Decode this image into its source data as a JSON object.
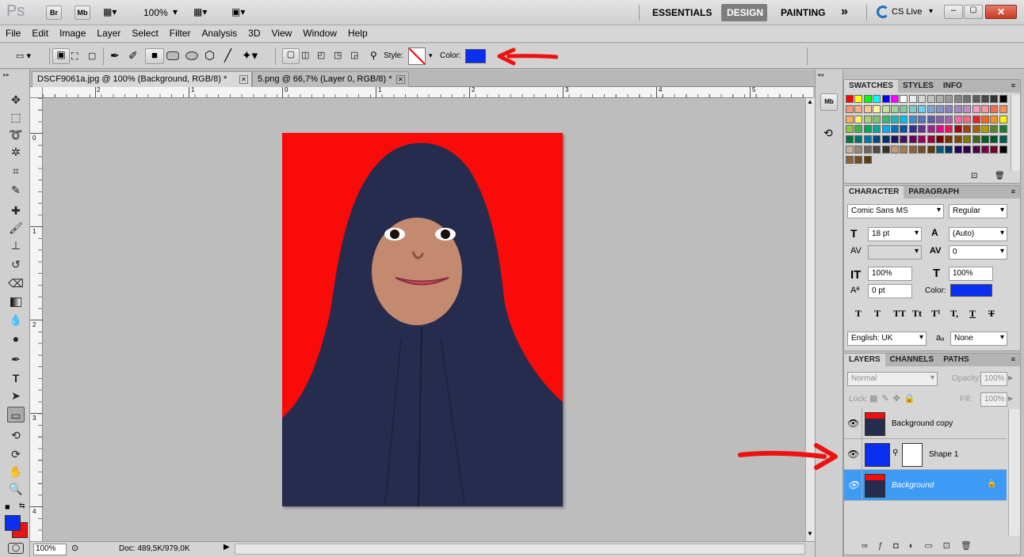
{
  "app": {
    "logo": "Ps",
    "zoom": "100%",
    "workspaces": [
      "ESSENTIALS",
      "DESIGN",
      "PAINTING"
    ],
    "active_workspace": "DESIGN",
    "more": "»",
    "cslive": "CS Live"
  },
  "menu": [
    "File",
    "Edit",
    "Image",
    "Layer",
    "Select",
    "Filter",
    "Analysis",
    "3D",
    "View",
    "Window",
    "Help"
  ],
  "options": {
    "style_label": "Style:",
    "color_label": "Color:",
    "color": "#0a2ff0"
  },
  "tabs": [
    {
      "label": "DSCF9061a.jpg @ 100% (Background, RGB/8) *",
      "active": true
    },
    {
      "label": "5.png @ 66,7% (Layer 0, RGB/8) *",
      "active": false
    }
  ],
  "ruler": {
    "h": [
      "2",
      "1",
      "0",
      "1",
      "2",
      "3",
      "4",
      "5"
    ],
    "v": [
      "0",
      "1",
      "2",
      "3",
      "4"
    ]
  },
  "status": {
    "zoom": "100%",
    "doc": "Doc: 489,5K/979,0K"
  },
  "swatches": {
    "tabs": [
      "SWATCHES",
      "STYLES",
      "INFO"
    ]
  },
  "character": {
    "tabs": [
      "CHARACTER",
      "PARAGRAPH"
    ],
    "font": "Comic Sans MS",
    "style": "Regular",
    "size": "18 pt",
    "leading": "(Auto)",
    "tracking": "0",
    "vscale": "100%",
    "hscale": "100%",
    "baseline": "0 pt",
    "color_label": "Color:",
    "color": "#0a2ff0",
    "language": "English: UK",
    "aa_label": "aₐ",
    "antialias": "None",
    "typo": [
      "T",
      "T",
      "TT",
      "Tt",
      "T¹",
      "T,",
      "T",
      "T"
    ]
  },
  "layers": {
    "tabs": [
      "LAYERS",
      "CHANNELS",
      "PATHS"
    ],
    "blend": "Normal",
    "opacity_label": "Opacity:",
    "opacity": "100%",
    "lock_label": "Lock:",
    "fill_label": "Fill:",
    "fill": "100%",
    "items": [
      {
        "name": "Background copy",
        "selected": false
      },
      {
        "name": "Shape 1",
        "selected": false
      },
      {
        "name": "Background",
        "selected": true
      }
    ]
  },
  "colors": {
    "foreground": "#0a2ff0",
    "background": "#ee1111",
    "canvas_red": "#fb0a0a",
    "annotation_red": "#ef1010",
    "selection": "#3d9bf5"
  }
}
